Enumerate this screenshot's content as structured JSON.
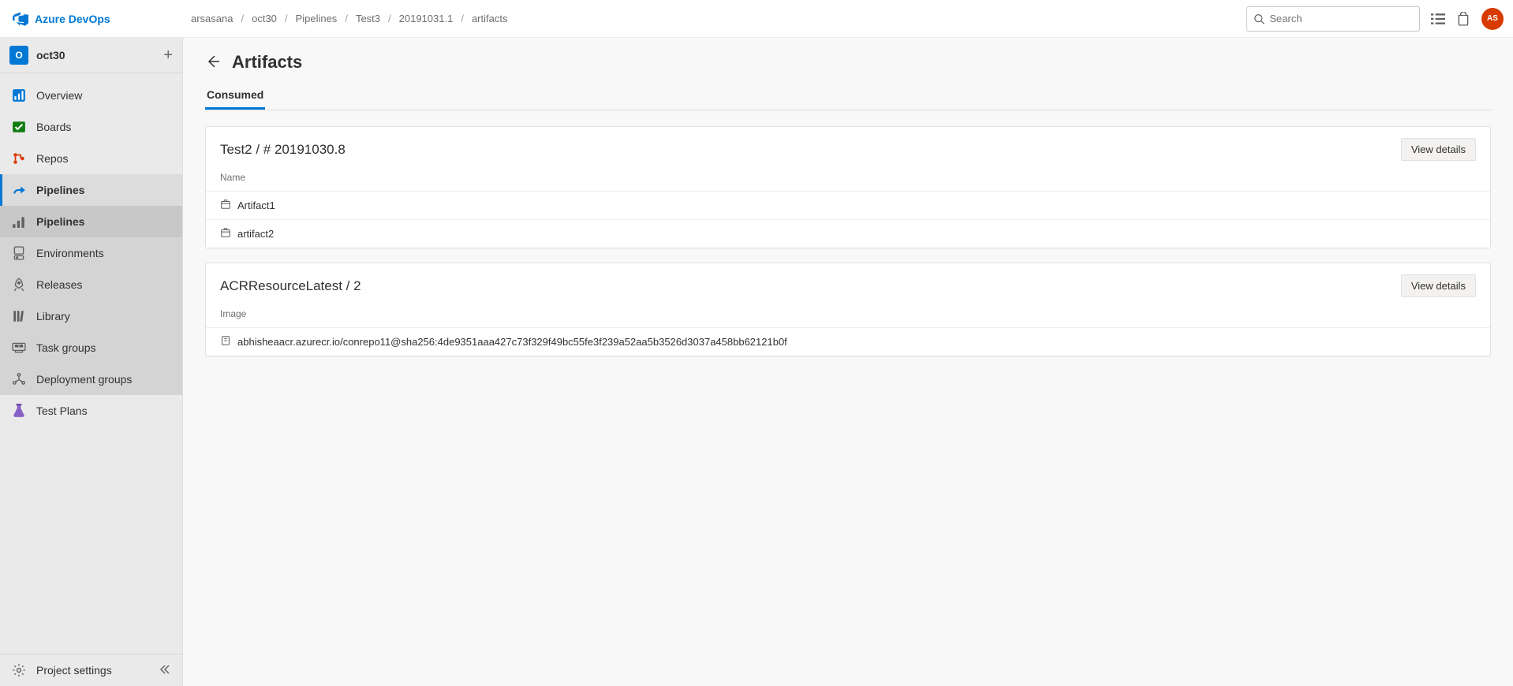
{
  "header": {
    "product_name": "Azure DevOps",
    "breadcrumb": [
      "arsasana",
      "oct30",
      "Pipelines",
      "Test3",
      "20191031.1",
      "artifacts"
    ],
    "search_placeholder": "Search",
    "avatar_initials": "AS"
  },
  "sidebar": {
    "project_badge": "O",
    "project_name": "oct30",
    "items": [
      {
        "label": "Overview",
        "icon": "overview"
      },
      {
        "label": "Boards",
        "icon": "boards"
      },
      {
        "label": "Repos",
        "icon": "repos"
      },
      {
        "label": "Pipelines",
        "icon": "pipelines",
        "selected": true
      },
      {
        "label": "Pipelines",
        "icon": "sub-pipelines",
        "sub": true,
        "active": true
      },
      {
        "label": "Environments",
        "icon": "environments",
        "sub": true
      },
      {
        "label": "Releases",
        "icon": "releases",
        "sub": true
      },
      {
        "label": "Library",
        "icon": "library",
        "sub": true
      },
      {
        "label": "Task groups",
        "icon": "taskgroups",
        "sub": true
      },
      {
        "label": "Deployment groups",
        "icon": "deploymentgroups",
        "sub": true
      },
      {
        "label": "Test Plans",
        "icon": "testplans"
      }
    ],
    "footer_label": "Project settings"
  },
  "main": {
    "page_title": "Artifacts",
    "tab_label": "Consumed",
    "cards": [
      {
        "title": "Test2 / # 20191030.8",
        "column": "Name",
        "view_details": "View details",
        "rows": [
          {
            "label": "Artifact1",
            "type": "artifact"
          },
          {
            "label": "artifact2",
            "type": "artifact"
          }
        ]
      },
      {
        "title": "ACRResourceLatest / 2",
        "column": "Image",
        "view_details": "View details",
        "rows": [
          {
            "label": "abhisheaacr.azurecr.io/conrepo11@sha256:4de9351aaa427c73f329f49bc55fe3f239a52aa5b3526d3037a458bb62121b0f",
            "type": "image"
          }
        ]
      }
    ]
  }
}
